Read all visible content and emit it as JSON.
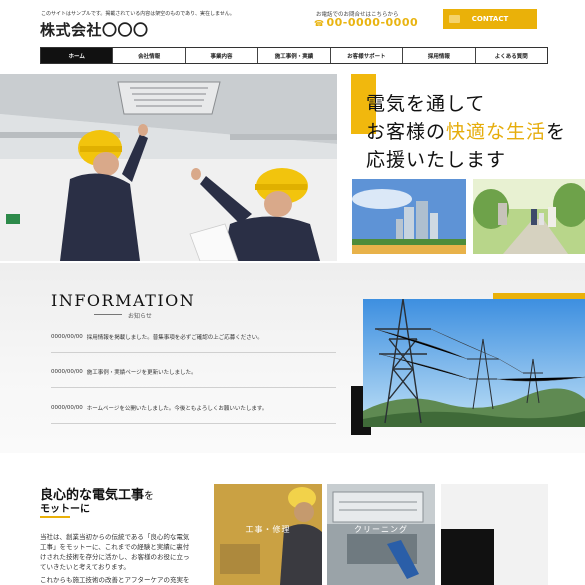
{
  "header": {
    "notice": "このサイトはサンプルです。掲載されている内容は架空のものであり、実在しません。",
    "company_name": "株式会社〇〇〇",
    "tel_label": "お電話でのお問合せはこちらから",
    "tel_number": "00-0000-0000",
    "contact_label": "CONTACT"
  },
  "nav": {
    "items": [
      "ホーム",
      "会社情報",
      "事業内容",
      "施工事例・実績",
      "お客様サポート",
      "採用情報",
      "よくある質問"
    ]
  },
  "hero": {
    "line1": "電気を通して",
    "line2_pre": "お客様の",
    "line2_accent": "快適な生活",
    "line2_post": "を",
    "line3": "応援いたします"
  },
  "information": {
    "title": "INFORMATION",
    "subtitle": "お知らせ",
    "items": [
      {
        "date": "0000/00/00",
        "text": "採用情報を掲載しました。普集事項を必ずご確認の上ご応募ください。"
      },
      {
        "date": "0000/00/00",
        "text": "施工事例・実績ページを更新いたしました。"
      },
      {
        "date": "0000/00/00",
        "text": "ホームページを公開いたしました。今後ともよろしくお願いいたします。"
      }
    ]
  },
  "motto": {
    "heading_main": "良心的な電気工事",
    "heading_particle": "を",
    "heading_line2": "モットーに",
    "body_lines": [
      "当社は、創業当初からの伝統である「良心的な電気",
      "工事」をモットーに、これまでの経験と実績に裏付",
      "けされた技術を存分に活かし、お客様のお役に立っ",
      "ていきたいと考えております。"
    ],
    "body_line5": "これからも施工技術の改善とアフターケアの充実を"
  },
  "services": {
    "cards": [
      {
        "label": "工事・修理"
      },
      {
        "label": "クリーニング"
      }
    ]
  },
  "colors": {
    "accent": "#eab109",
    "dark": "#111111"
  }
}
